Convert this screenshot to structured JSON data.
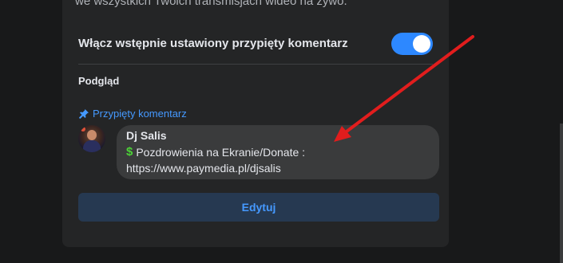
{
  "settings": {
    "description_fragment": "we wszystkich Twoich transmisjach wideo na żywo.",
    "toggle_label": "Włącz wstępnie ustawiony przypięty komentarz",
    "toggle_enabled": true,
    "preview_label": "Podgląd"
  },
  "pinned_comment": {
    "header": "Przypięty komentarz",
    "author": "Dj Salis",
    "text_line1": "Pozdrowienia na Ekranie/Donate :",
    "text_line2": "https://www.paymedia.pl/djsalis"
  },
  "actions": {
    "edit_label": "Edytuj"
  },
  "colors": {
    "accent": "#2d88ff",
    "link": "#4599ff",
    "annotation_arrow": "#e11d1d"
  },
  "icons": {
    "pin": "pin-icon",
    "dollar": "dollar-icon"
  }
}
